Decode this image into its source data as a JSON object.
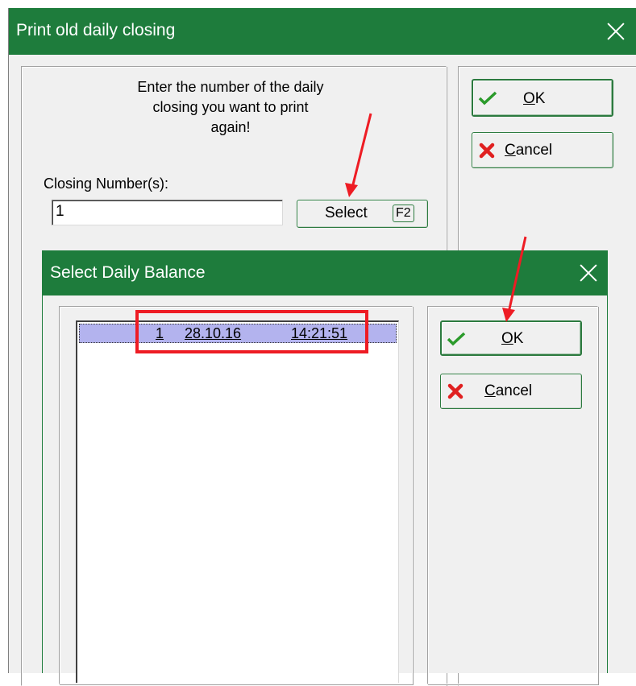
{
  "print_dialog": {
    "title": "Print old daily closing",
    "instruction": "Enter the number of the daily closing you want to print again!",
    "instruction_lines": [
      "Enter the number of the daily",
      "closing you want to print",
      "again!"
    ],
    "closing_label": "Closing Number(s):",
    "closing_value": "1",
    "select_label": "Select",
    "select_key": "F2",
    "ok_mnemonic": "O",
    "ok_rest": "K",
    "cancel_mnemonic": "C",
    "cancel_rest": "ancel"
  },
  "select_dialog": {
    "title": "Select Daily Balance",
    "rows": [
      {
        "number": "1",
        "date": "28.10.16",
        "time": "14:21:51"
      }
    ],
    "ok_mnemonic": "O",
    "ok_rest": "K",
    "cancel_mnemonic": "C",
    "cancel_rest": "ancel"
  },
  "colors": {
    "titlebar": "#1e7c3c",
    "selection": "#b3b3ee",
    "annotation": "#ee1c24"
  }
}
